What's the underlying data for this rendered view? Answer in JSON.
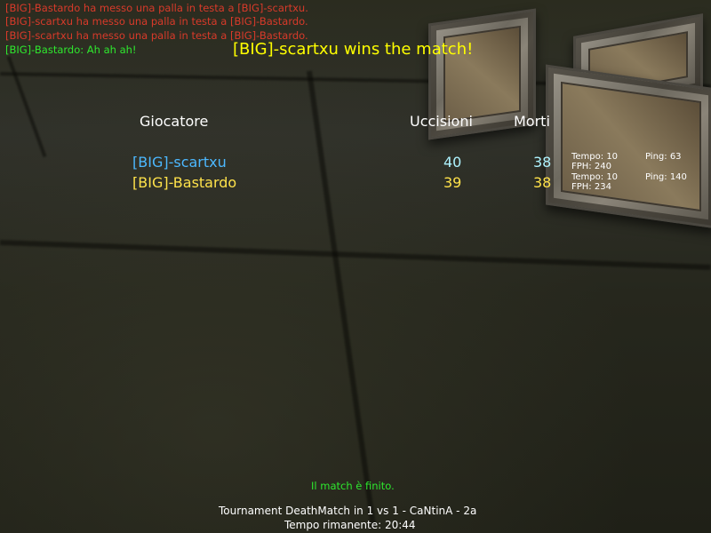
{
  "chat": [
    {
      "text": "[BIG]-Bastardo ha messo una palla in testa a [BIG]-scartxu.",
      "color": "#d83a2a"
    },
    {
      "text": "[BIG]-scartxu ha messo una palla in testa a [BIG]-Bastardo.",
      "color": "#d83a2a"
    },
    {
      "text": "[BIG]-scartxu ha messo una palla in testa a [BIG]-Bastardo.",
      "color": "#d83a2a"
    },
    {
      "text": "[BIG]-Bastardo: Ah ah ah!",
      "color": "#2ee82e"
    }
  ],
  "winner_message": "[BIG]-scartxu wins the match!",
  "scoreboard": {
    "headers": {
      "player": "Giocatore",
      "kills": "Uccisioni",
      "deaths": "Morti"
    },
    "rows": [
      {
        "name": "[BIG]-scartxu",
        "kills": "40",
        "deaths": "38",
        "time": "Tempo: 10",
        "fph": "FPH: 240",
        "ping": "Ping: 63"
      },
      {
        "name": "[BIG]-Bastardo",
        "kills": "39",
        "deaths": "38",
        "time": "Tempo: 10",
        "fph": "FPH: 234",
        "ping": "Ping: 140"
      }
    ]
  },
  "status_message": "Il match è finito.",
  "footer": {
    "line1": "Tournament DeathMatch in 1 vs 1 - CaNtinA - 2a",
    "line2": "Tempo rimanente:  20:44"
  }
}
